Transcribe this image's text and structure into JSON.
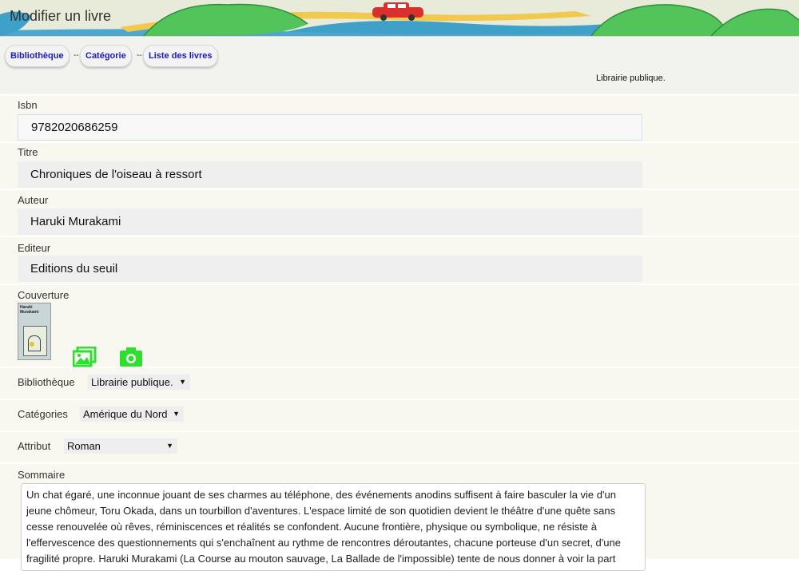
{
  "header": {
    "title": "Modifier un livre"
  },
  "breadcrumb": {
    "items": [
      "Bibliothèque",
      "Catégorie",
      "Liste des livres"
    ],
    "separator": "--"
  },
  "library_name": "Librairie publique.",
  "form": {
    "isbn": {
      "label": "Isbn",
      "value": "9782020686259"
    },
    "titre": {
      "label": "Titre",
      "value": "Chroniques de l'oiseau à ressort"
    },
    "auteur": {
      "label": "Auteur",
      "value": "Haruki Murakami"
    },
    "editeur": {
      "label": "Editeur",
      "value": "Editions du seuil"
    },
    "couverture": {
      "label": "Couverture",
      "cover_author": "Haruki Murakami"
    },
    "bibliotheque": {
      "label": "Bibliothèque",
      "selected": "Librairie publique."
    },
    "categories": {
      "label": "Catégories",
      "selected": "Amérique du Nord"
    },
    "attribut": {
      "label": "Attribut",
      "selected": "Roman"
    },
    "sommaire": {
      "label": "Sommaire",
      "value": "Un chat égaré, une inconnue jouant de ses charmes au téléphone, des événements anodins suffisent à faire basculer la vie d'un jeune chômeur, Toru Okada, dans un tourbillon d'aventures. L'espace limité de son quotidien devient le théâtre d'une quête sans cesse renouvelée où rêves, réminiscences et réalités se confondent. Aucune frontière, physique ou symbolique, ne résiste à l'effervescence des questionnements qui s'enchaînent au rythme de rencontres déroutantes, chacune porteuse d'un secret, d'une fragilité propre. Haruki Murakami (La Course au mouton sauvage, La Ballade de l'impossible) tente de nous donner à voir la part"
    }
  },
  "icons": {
    "gallery": "image-gallery-icon",
    "camera": "camera-icon"
  },
  "colors": {
    "accent_green": "#2ee02e",
    "link": "#1a1acb",
    "row_bg": "#f8f7f0",
    "field_bg": "#efefef"
  }
}
